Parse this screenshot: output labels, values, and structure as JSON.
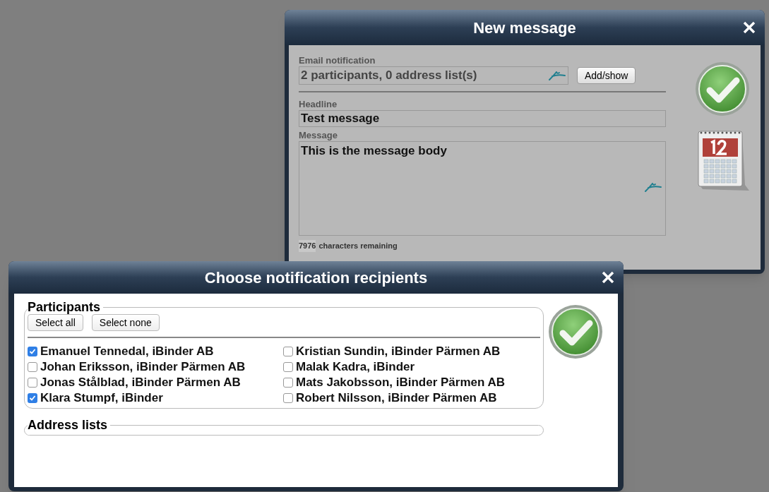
{
  "message_window": {
    "title": "New message",
    "email_notification": {
      "label": "Email notification",
      "value": "2 participants, 0 address list(s)",
      "button": "Add/show"
    },
    "headline": {
      "label": "Headline",
      "value": "Test message"
    },
    "message": {
      "label": "Message",
      "value": "This is the message body"
    },
    "remaining": {
      "count": "7976",
      "label": "characters remaining"
    }
  },
  "recipients_window": {
    "title": "Choose notification recipients",
    "participants": {
      "legend": "Participants",
      "buttons": [
        "Select all",
        "Select none"
      ],
      "people": [
        {
          "label": "Emanuel Tennedal, iBinder AB",
          "checked": true
        },
        {
          "label": "Johan Eriksson, iBinder Pärmen AB",
          "checked": false
        },
        {
          "label": "Jonas Stålblad, iBinder Pärmen AB",
          "checked": false
        },
        {
          "label": "Klara Stumpf, iBinder",
          "checked": true
        },
        {
          "label": "Kristian Sundin, iBinder Pärmen AB",
          "checked": false
        },
        {
          "label": "Malak Kadra, iBinder",
          "checked": false
        },
        {
          "label": "Mats Jakobsson, iBinder Pärmen AB",
          "checked": false
        },
        {
          "label": "Robert Nilsson, iBinder Pärmen AB",
          "checked": false
        }
      ]
    },
    "address_lists": {
      "legend": "Address lists"
    }
  }
}
